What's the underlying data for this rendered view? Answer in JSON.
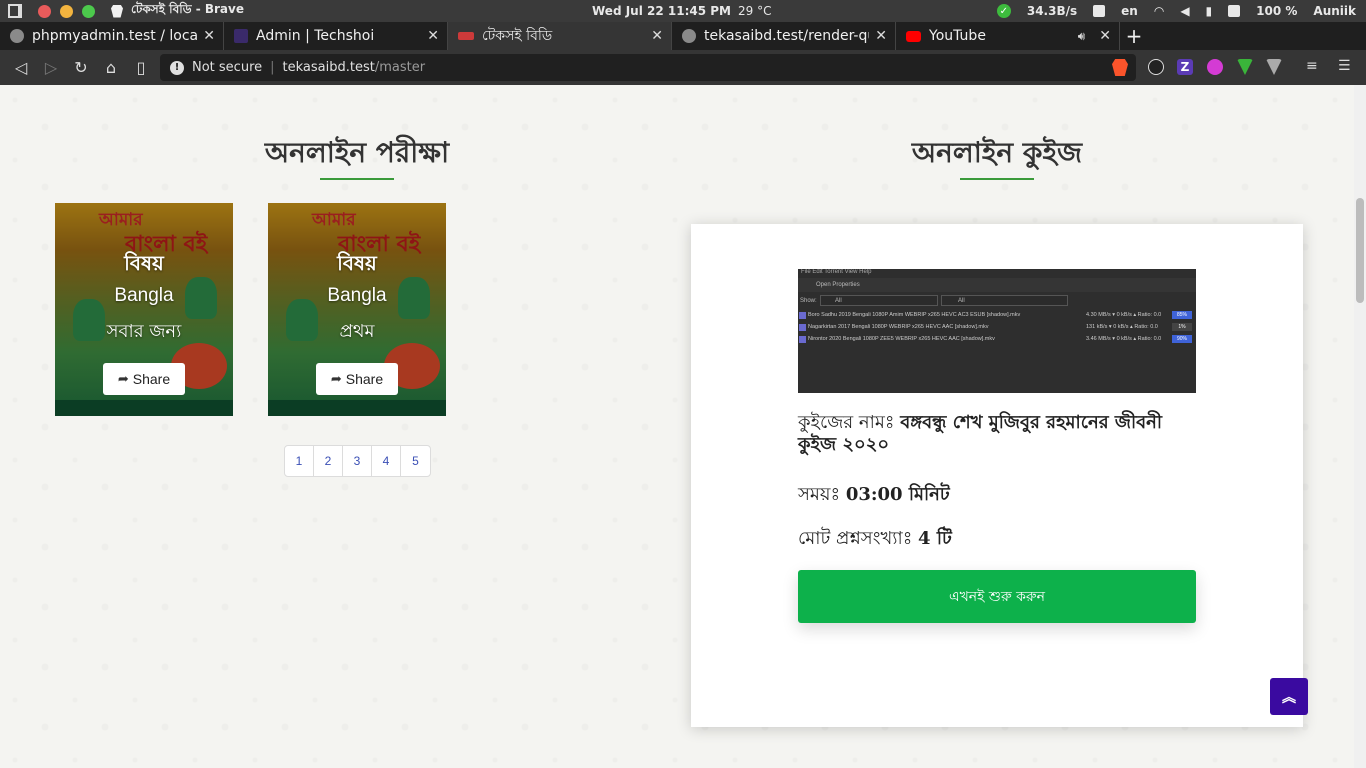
{
  "os": {
    "window_title": "টেকসই বিডি - Brave",
    "clock": "Wed Jul 22  11:45 PM",
    "weather": "29 °C",
    "net_speed": "34.3B/s",
    "language": "en",
    "battery": "100 %",
    "user": "Auniik"
  },
  "tabs": [
    {
      "label": "phpmyadmin.test / localho",
      "icon": "globe-icon"
    },
    {
      "label": "Admin | Techshoi",
      "icon": "site-icon"
    },
    {
      "label": "টেকসই বিডি",
      "icon": "tbd-icon"
    },
    {
      "label": "tekasaibd.test/render-que",
      "icon": "globe-icon"
    },
    {
      "label": "YouTube",
      "icon": "youtube-icon"
    }
  ],
  "address_bar": {
    "security": "Not secure",
    "host": "tekasaibd.test",
    "path": "/master"
  },
  "exam_section": {
    "title": "অনলাইন পরীক্ষা",
    "books": [
      {
        "cover_top": "আমার",
        "cover_main": "বাংলা বই",
        "heading": "বিষয়",
        "subject": "Bangla",
        "level": "সবার জন্য",
        "share": "Share"
      },
      {
        "cover_top": "আমার",
        "cover_main": "বাংলা বই",
        "heading": "বিষয়",
        "subject": "Bangla",
        "level": "প্রথম",
        "share": "Share"
      }
    ],
    "pages": [
      "1",
      "2",
      "3",
      "4",
      "5"
    ]
  },
  "quiz_section": {
    "title": "অনলাইন কুইজ",
    "screenshot": {
      "menu": "File   Edit   Torrent   View   Help",
      "toolbar": "Open                                       Properties",
      "show_label": "Show:",
      "filter_a": "All",
      "filter_b": "All",
      "rows": [
        {
          "name": "Boro Sadhu 2019 Bengali 1080P Amim WEBRIP x265 HEVC AC3 ESUB [shadow].mkv",
          "speed": "4.30 MB/s ▾   0 kB/s ▴   Ratio: 0.0",
          "pct": "85%"
        },
        {
          "name": "Nagarkirtan 2017 Bengali 1080P WEBRIP x265 HEVC AAC [shadow].mkv",
          "speed": "131 kB/s ▾   0 kB/s ▴   Ratio: 0.0",
          "pct": "1%"
        },
        {
          "name": "Nirontor 2020 Bengali 1080P ZEE5 WEBRIP x265 HEVC AAC [shadow].mkv",
          "speed": "3.46 MB/s ▾   0 kB/s ▴   Ratio: 0.0",
          "pct": "90%"
        }
      ]
    },
    "name_label": "কুইজের নামঃ ",
    "name_value": "বঙ্গবন্ধু শেখ মুজিবুর রহমানের জীবনী কুইজ ২০২০",
    "time_label": "সময়ঃ ",
    "time_value": "03:00 মিনিট",
    "count_label": "মোট প্রশ্নসংখ্যাঃ ",
    "count_value": "4 টি",
    "start_button": "এখনই শুরু করুন"
  },
  "scroll_top_icon": "double-chevron-up-icon"
}
